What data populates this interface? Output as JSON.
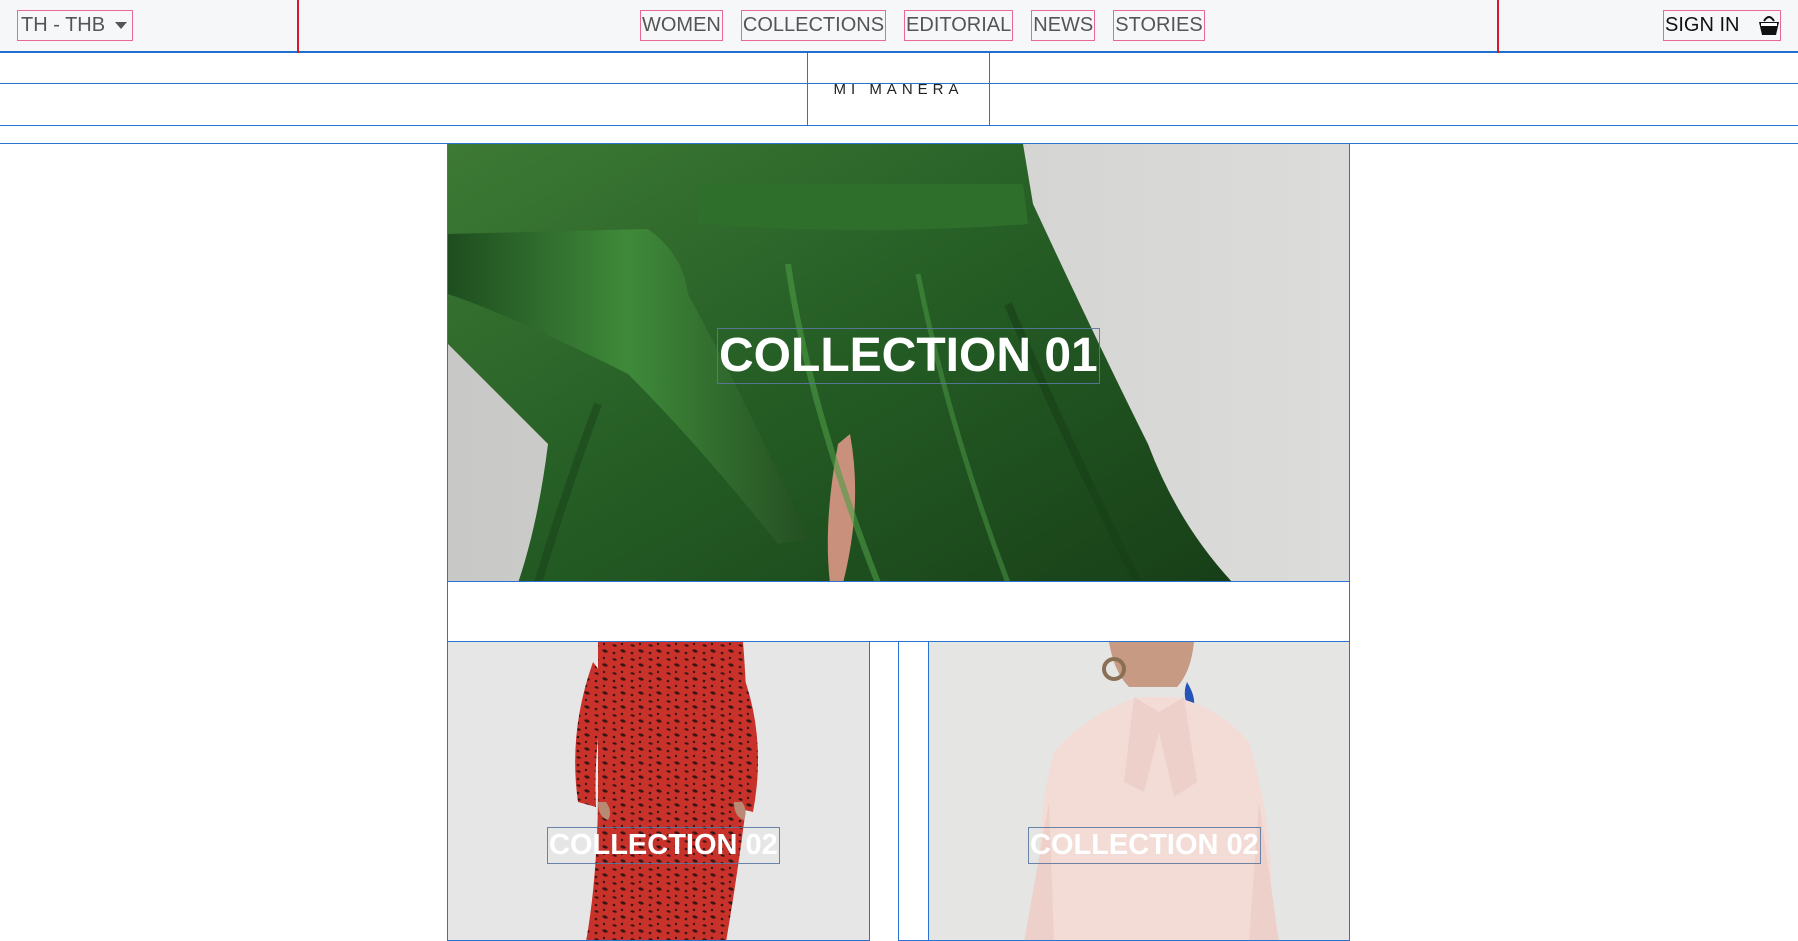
{
  "header": {
    "currency": "TH - THB",
    "nav": [
      "WOMEN",
      "COLLECTIONS",
      "EDITORIAL",
      "NEWS",
      "STORIES"
    ],
    "sign_in": "SIGN IN",
    "bag_icon": "shopping-bag-icon"
  },
  "brand": {
    "logo": "MI MANERA"
  },
  "collections": {
    "hero": {
      "title": "COLLECTION 01"
    },
    "tiles": [
      {
        "title": "COLLECTION 02"
      },
      {
        "title": "COLLECTION 02"
      }
    ]
  },
  "colors": {
    "accent_blue": "#2b73d0",
    "divider_red": "#d41a2a",
    "outline_pink": "#e86a93",
    "dress_green": "#2f6b2c",
    "dress_red": "#c2302a",
    "blouse_pink": "#f3dcd6"
  }
}
